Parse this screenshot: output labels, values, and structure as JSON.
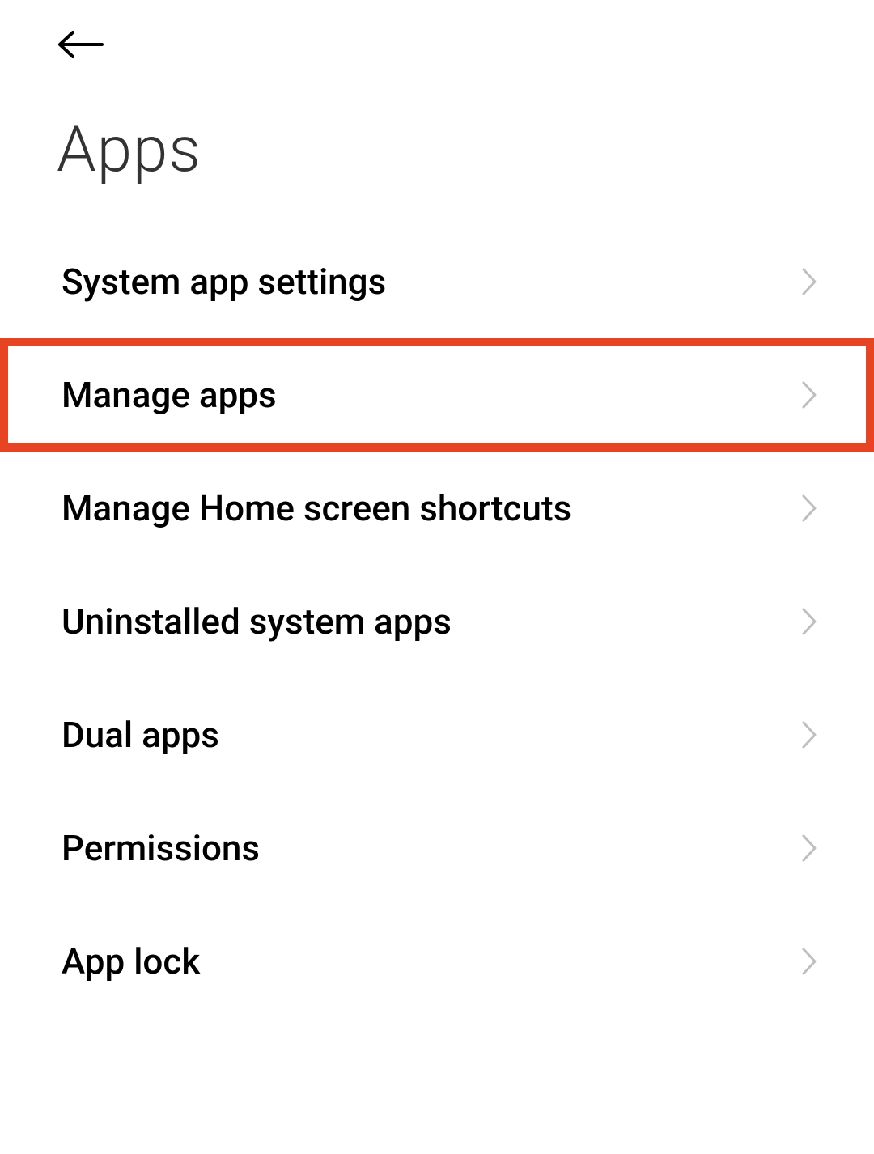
{
  "header": {
    "title": "Apps"
  },
  "items": [
    {
      "label": "System app settings",
      "highlighted": false
    },
    {
      "label": "Manage apps",
      "highlighted": true
    },
    {
      "label": "Manage Home screen shortcuts",
      "highlighted": false
    },
    {
      "label": "Uninstalled system apps",
      "highlighted": false
    },
    {
      "label": "Dual apps",
      "highlighted": false
    },
    {
      "label": "Permissions",
      "highlighted": false
    },
    {
      "label": "App lock",
      "highlighted": false
    }
  ]
}
